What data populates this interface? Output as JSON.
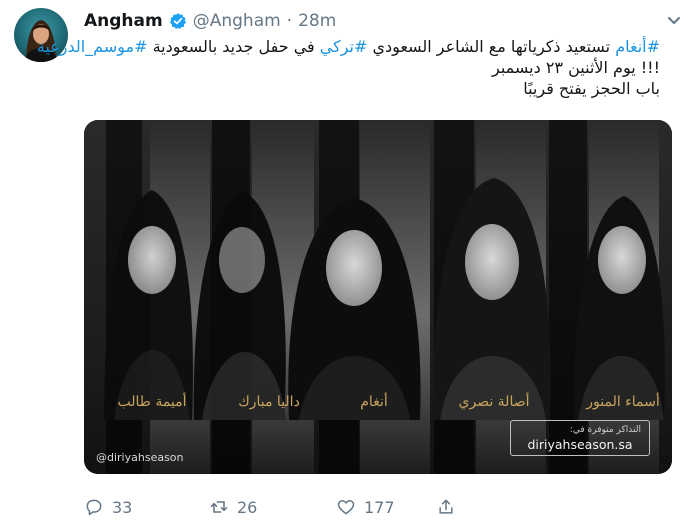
{
  "author": {
    "name": "Angham",
    "handle": "@Angham",
    "separator": "·",
    "time": "28m",
    "verified": true
  },
  "tweet": {
    "line1": {
      "t1": "#أنغام",
      "t2": " تستعيد ذكرياتها مع الشاعر السعودي ",
      "t3": "#تركي",
      "t4": " في حفل جديد بالسعودية ",
      "t5": "#موسم_الدرعية"
    },
    "line2": "!!! يوم الأثنين ٢٣ ديسمبر",
    "line3": "باب الحجز يفتح قريبًا"
  },
  "media": {
    "artists": [
      "أسماء المنور",
      "أصالة نصري",
      "أنغام",
      "داليا مبارك",
      "أميمة طالب"
    ],
    "ticket_caption": "التذاكر متوفرة في:",
    "ticket_url": "diriyahseason.sa",
    "watermark": "@diriyahseason"
  },
  "stats": {
    "replies": "33",
    "retweets": "26",
    "likes": "177"
  },
  "colors": {
    "link": "#1b95e0",
    "text": "#14171a",
    "muted": "#657786",
    "gold": "#c9a55c",
    "verified": "#1da1f2"
  },
  "icons": [
    "chevron-down-icon",
    "verified-badge-icon",
    "reply-icon",
    "retweet-icon",
    "like-icon",
    "share-icon"
  ]
}
